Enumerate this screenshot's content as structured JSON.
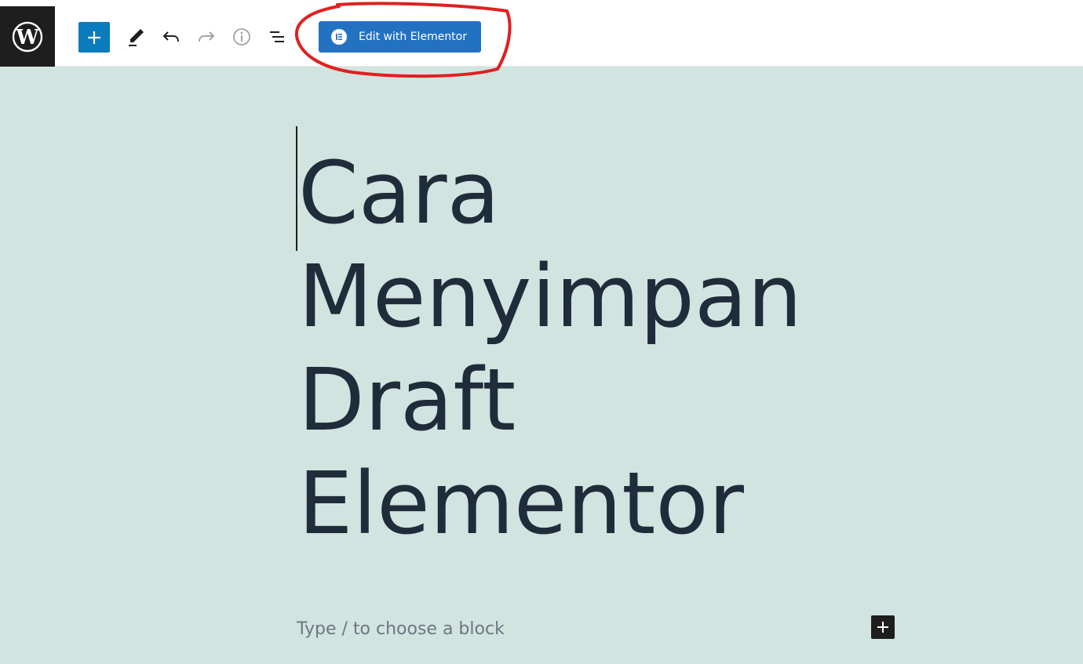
{
  "toolbar": {
    "elementor_button_label": "Edit with Elementor",
    "icons": {
      "logo": "wordpress-logo-icon",
      "add": "plus-icon",
      "edit": "pencil-icon",
      "undo": "undo-icon",
      "redo": "redo-icon",
      "info": "info-icon",
      "list_view": "list-view-icon",
      "elementor": "elementor-icon"
    }
  },
  "editor": {
    "title": "Cara Menyimpan Draft Elementor",
    "block_placeholder": "Type / to choose a block"
  },
  "colors": {
    "canvas_background": "#d1e4e0",
    "primary_blue": "#0a7bbd",
    "elementor_blue": "#2372c1",
    "annotation_red": "#e02020",
    "title_text": "#1f2d3a"
  }
}
